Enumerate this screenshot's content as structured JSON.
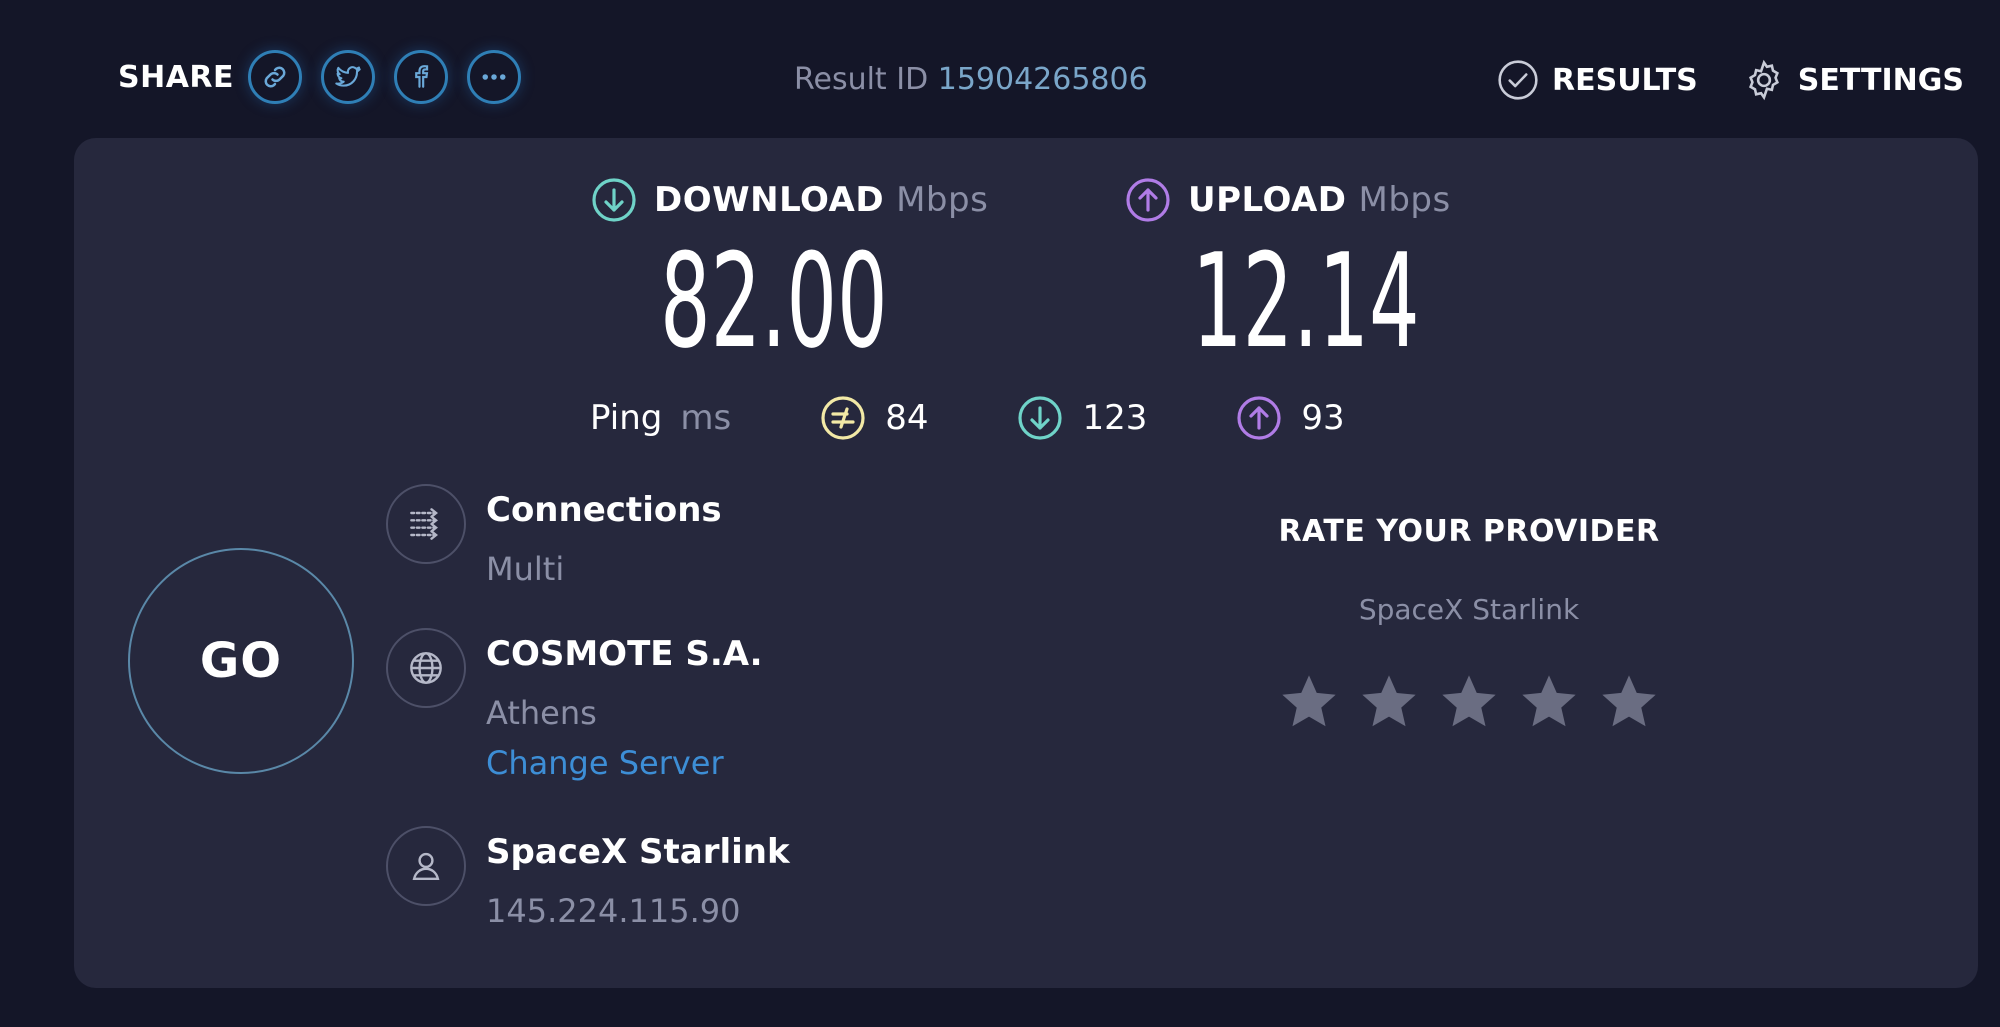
{
  "header": {
    "share_label": "SHARE",
    "share_buttons": [
      "link-icon",
      "twitter-icon",
      "facebook-icon",
      "more-icon"
    ],
    "result_id_label": "Result ID",
    "result_id_value": "15904265806",
    "results_label": "RESULTS",
    "settings_label": "SETTINGS"
  },
  "download": {
    "label": "DOWNLOAD",
    "unit": "Mbps",
    "value": "82.00",
    "color": "#6fd3c8"
  },
  "upload": {
    "label": "UPLOAD",
    "unit": "Mbps",
    "value": "12.14",
    "color": "#b07ce6"
  },
  "ping": {
    "label": "Ping",
    "unit": "ms",
    "idle": "84",
    "download": "123",
    "upload": "93",
    "idle_color": "#f2e9a6"
  },
  "go_label": "GO",
  "connections": {
    "title": "Connections",
    "value": "Multi"
  },
  "server": {
    "name": "COSMOTE S.A.",
    "location": "Athens",
    "change_label": "Change Server"
  },
  "client": {
    "isp": "SpaceX Starlink",
    "ip": "145.224.115.90"
  },
  "rating": {
    "title": "RATE YOUR PROVIDER",
    "provider": "SpaceX Starlink",
    "stars_filled": 0,
    "stars_total": 5
  },
  "colors": {
    "background": "#141628",
    "panel": "#26283d",
    "accent_blue": "#3d8ed6",
    "muted": "#8b8fa6"
  }
}
